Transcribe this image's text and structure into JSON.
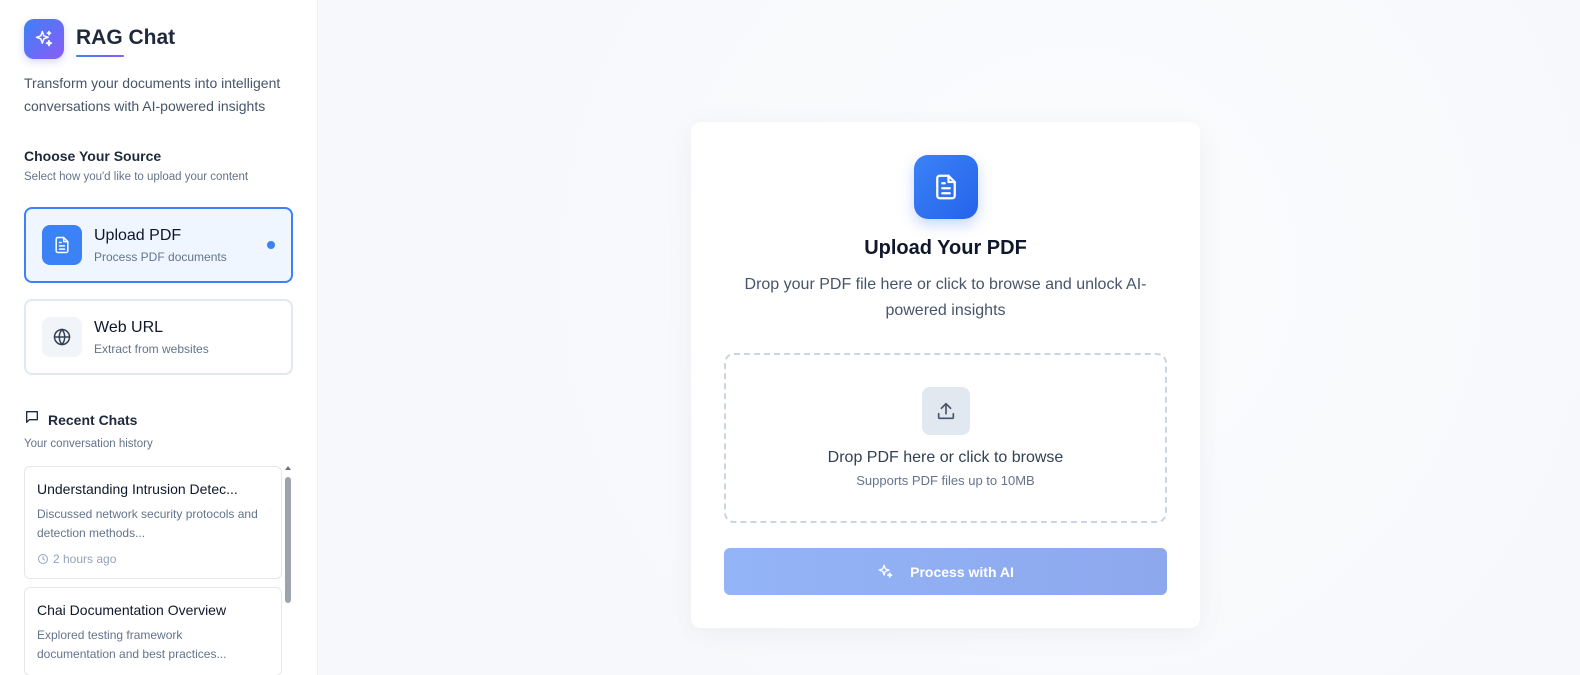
{
  "brand": {
    "title": "RAG Chat",
    "tagline": "Transform your documents into intelligent conversations with AI-powered insights"
  },
  "source": {
    "title": "Choose Your Source",
    "subtitle": "Select how you'd like to upload your content",
    "options": [
      {
        "title": "Upload PDF",
        "desc": "Process PDF documents",
        "icon": "document-icon",
        "active": true
      },
      {
        "title": "Web URL",
        "desc": "Extract from websites",
        "icon": "globe-icon",
        "active": false
      }
    ]
  },
  "recent": {
    "title": "Recent Chats",
    "subtitle": "Your conversation history",
    "chats": [
      {
        "title": "Understanding Intrusion Detec...",
        "desc": "Discussed network security protocols and detection methods...",
        "time": "2 hours ago"
      },
      {
        "title": "Chai Documentation Overview",
        "desc": "Explored testing framework documentation and best practices..."
      }
    ]
  },
  "upload": {
    "title": "Upload Your PDF",
    "desc": "Drop your PDF file here or click to browse and unlock AI-powered insights",
    "drop_title": "Drop PDF here or click to browse",
    "drop_sub": "Supports PDF files up to 10MB",
    "button": "Process with AI"
  },
  "colors": {
    "accent": "#3b82f6",
    "brand_gradient_start": "#3b82f6",
    "brand_gradient_end": "#8b5cf6",
    "button_disabled": "#93b4f6"
  }
}
